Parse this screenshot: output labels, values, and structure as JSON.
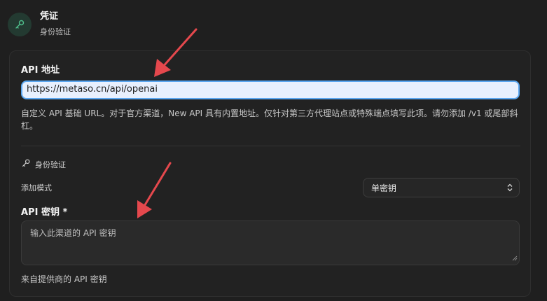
{
  "header": {
    "title": "凭证",
    "subtitle": "身份验证",
    "icon": "key-icon",
    "icon_color": "#4fbf8c"
  },
  "api_address": {
    "label": "API 地址",
    "value": "https://metaso.cn/api/openai",
    "help": "自定义 API 基础 URL。对于官方渠道，New API 具有内置地址。仅针对第三方代理站点或特殊端点填写此项。请勿添加 /v1 或尾部斜杠。"
  },
  "auth_section": {
    "label": "身份验证",
    "icon": "key-icon"
  },
  "add_mode": {
    "label": "添加模式",
    "selected": "单密钥"
  },
  "api_key": {
    "label": "API 密钥 *",
    "placeholder": "输入此渠道的 API 密钥",
    "help": "来自提供商的 API 密钥"
  },
  "annotations": {
    "arrow_color": "#e5484d"
  }
}
